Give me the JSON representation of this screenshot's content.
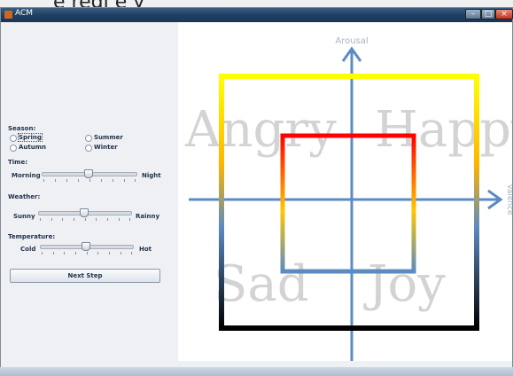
{
  "window": {
    "title": "ACM"
  },
  "top_caption": "e regi        e                  y",
  "season": {
    "label": "Season:",
    "options": [
      "Spring",
      "Summer",
      "Autumn",
      "Winter"
    ]
  },
  "time": {
    "label": "Time:",
    "left": "Morning",
    "right": "Night",
    "value": 0.5
  },
  "weather": {
    "label": "Weather:",
    "left": "Sunny",
    "right": "Rainny",
    "value": 0.5
  },
  "temperature": {
    "label": "Temperature:",
    "left": "Cold",
    "right": "Hot",
    "value": 0.5
  },
  "next_button": "Next Step",
  "chart": {
    "y_axis_label": "Arousal",
    "x_axis_label": "Valence",
    "quadrants": [
      "Angry",
      "Happy",
      "Sad",
      "Joy"
    ],
    "colors": {
      "axis": "#5b8bc2",
      "yellow": "#ffff00",
      "red": "#ff0000",
      "black": "#000000",
      "blue": "#5b8bc2"
    }
  }
}
